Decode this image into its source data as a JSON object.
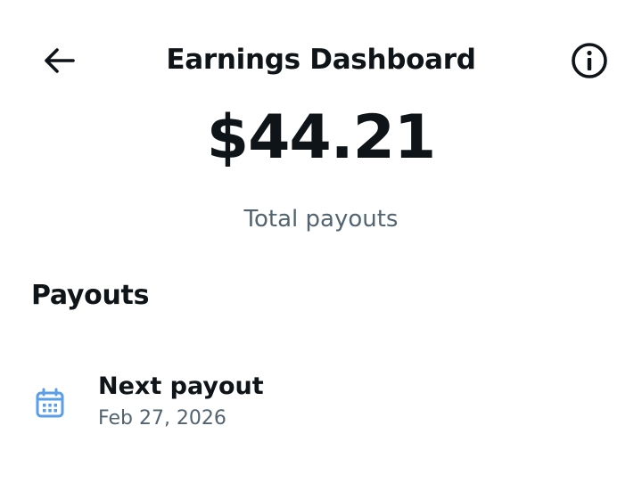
{
  "header": {
    "title": "Earnings Dashboard",
    "back_icon": "arrow-left-icon",
    "info_icon": "info-circle-icon"
  },
  "summary": {
    "amount": "$44.21",
    "label": "Total payouts"
  },
  "payouts": {
    "section_title": "Payouts",
    "items": [
      {
        "icon": "calendar-icon",
        "title": "Next payout",
        "date": "Feb 27, 2026"
      }
    ]
  },
  "colors": {
    "text_primary": "#0f1419",
    "text_secondary": "#536471",
    "calendar_icon": "#5b9ee8",
    "background": "#ffffff"
  }
}
